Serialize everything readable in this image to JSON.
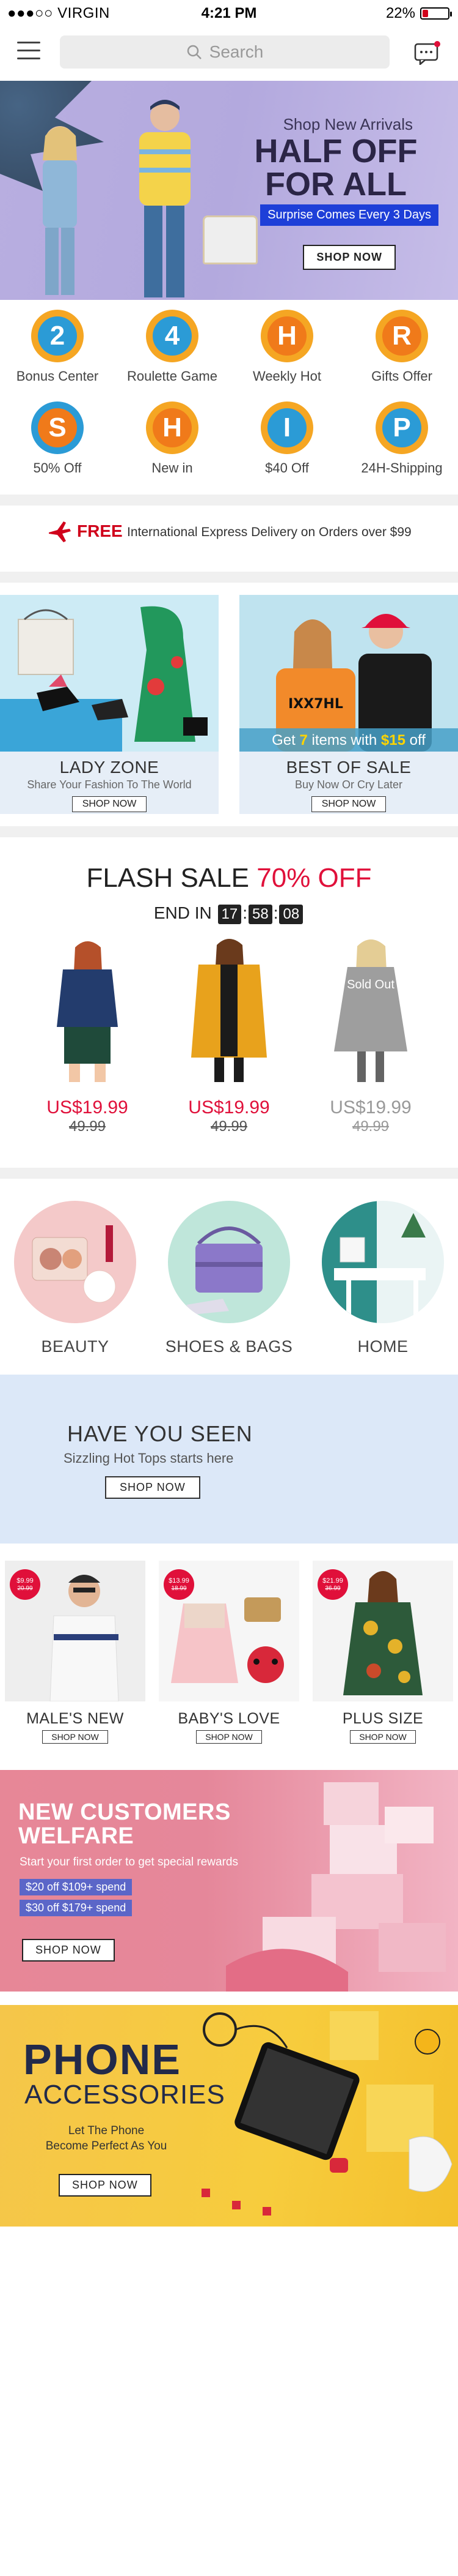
{
  "status_bar": {
    "carrier": "●●●○○ VIRGIN",
    "time": "4:21 PM",
    "battery_pct": "22%",
    "battery_level": 0.22
  },
  "header": {
    "search_placeholder": "Search"
  },
  "hero": {
    "subtitle": "Shop New Arrivals",
    "headline": "HALF OFF FOR ALL",
    "pill": "Surprise Comes Every 3 Days",
    "button": "SHOP NOW"
  },
  "grid": [
    {
      "letter": "2",
      "label": "Bonus Center",
      "color": "#2b9bd6",
      "ring": "#f5a623"
    },
    {
      "letter": "4",
      "label": "Roulette Game",
      "color": "#2b9bd6",
      "ring": "#f5a623"
    },
    {
      "letter": "H",
      "label": "Weekly Hot",
      "color": "#f07a1a",
      "ring": "#f5a623"
    },
    {
      "letter": "R",
      "label": "Gifts Offer",
      "color": "#f07a1a",
      "ring": "#f5a623"
    },
    {
      "letter": "S",
      "label": "50% Off",
      "color": "#f07a1a",
      "ring": "#2b9bd6"
    },
    {
      "letter": "H",
      "label": "New in",
      "color": "#f07a1a",
      "ring": "#f5a623"
    },
    {
      "letter": "I",
      "label": "$40 Off",
      "color": "#2b9bd6",
      "ring": "#f5a623"
    },
    {
      "letter": "P",
      "label": "24H-Shipping",
      "color": "#2b9bd6",
      "ring": "#f5a623"
    }
  ],
  "free_shipping": {
    "label": "FREE",
    "text": "International Express Delivery on Orders over $99"
  },
  "lady_zone": {
    "title": "LADY ZONE",
    "subtitle": "Share Your Fashion To The World",
    "button": "SHOP NOW"
  },
  "best_of_sale": {
    "overlay_pre": "Get ",
    "overlay_num": "7",
    "overlay_mid": " items with ",
    "overlay_price": "$15",
    "overlay_post": " off",
    "title": "BEST OF SALE",
    "subtitle": "Buy Now Or Cry Later",
    "button": "SHOP NOW"
  },
  "flash_sale": {
    "title": "FLASH SALE",
    "discount": "70% OFF",
    "end_label": "END IN",
    "hh": "17",
    "mm": "58",
    "ss": "08",
    "items": [
      {
        "price": "US$19.99",
        "old": "49.99",
        "sold_out": false
      },
      {
        "price": "US$19.99",
        "old": "49.99",
        "sold_out": false
      },
      {
        "price": "US$19.99",
        "old": "49.99",
        "sold_out": true,
        "sold_label": "Sold Out"
      }
    ]
  },
  "categories": [
    {
      "label": "BEAUTY"
    },
    {
      "label": "SHOES & BAGS"
    },
    {
      "label": "HOME"
    }
  ],
  "have_you_seen": {
    "title": "HAVE YOU SEEN",
    "subtitle": "Sizzling Hot Tops starts here",
    "button": "SHOP NOW"
  },
  "small_banners": [
    {
      "label": "MALE'S NEW",
      "price": "$9.99",
      "old": "20.99",
      "button": "SHOP NOW"
    },
    {
      "label": "BABY'S LOVE",
      "price": "$13.99",
      "old": "18.99",
      "button": "SHOP NOW"
    },
    {
      "label": "PLUS SIZE",
      "price": "$21.99",
      "old": "36.99",
      "button": "SHOP NOW"
    }
  ],
  "new_customers": {
    "line1": "NEW CUSTOMERS",
    "line2": "WELFARE",
    "subtitle": "Start your first order to get special rewards",
    "tag1": "$20 off  $109+ spend",
    "tag2": "$30 off  $179+ spend",
    "button": "SHOP NOW"
  },
  "phone_accessories": {
    "line1": "PHONE",
    "line2": "ACCESSORIES",
    "subtitle_1": "Let The Phone",
    "subtitle_2": "Become Perfect As You",
    "button": "SHOP NOW"
  }
}
